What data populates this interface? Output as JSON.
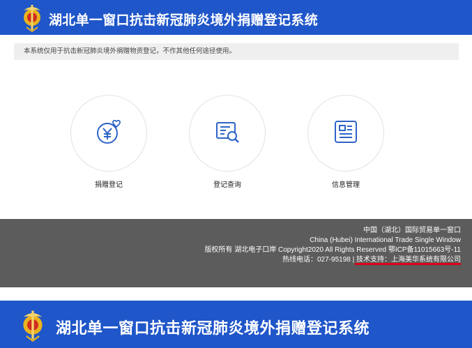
{
  "header": {
    "title": "湖北单一窗口抗击新冠肺炎境外捐赠登记系统",
    "logo_icon": "customs-emblem-icon"
  },
  "notice": {
    "text": "本系统仅用于抗击新冠肺炎境外捐赠物资登记，不作其他任何途径使用。"
  },
  "tiles": [
    {
      "label": "捐赠登记",
      "icon": "yuan-heart-icon"
    },
    {
      "label": "登记查询",
      "icon": "document-search-icon"
    },
    {
      "label": "信息管理",
      "icon": "profile-card-icon"
    }
  ],
  "footer": {
    "line1": "中国（湖北）国际贸易单一窗口",
    "line2": "China (Hubei) International Trade Single Window",
    "line3": "版权所有 湖北电子口岸 Copyright2020 All Rights Reserved 鄂ICP备11015663号-11",
    "hotline": "热线电话：027-95198",
    "separator": "|",
    "tech_support": "技术支持：上海美华系统有限公司"
  },
  "colors": {
    "header_bg": "#1f56c9",
    "footer_bg": "#5c5c5c",
    "icon_blue": "#2d63c8",
    "highlight_red": "#e0001a"
  }
}
